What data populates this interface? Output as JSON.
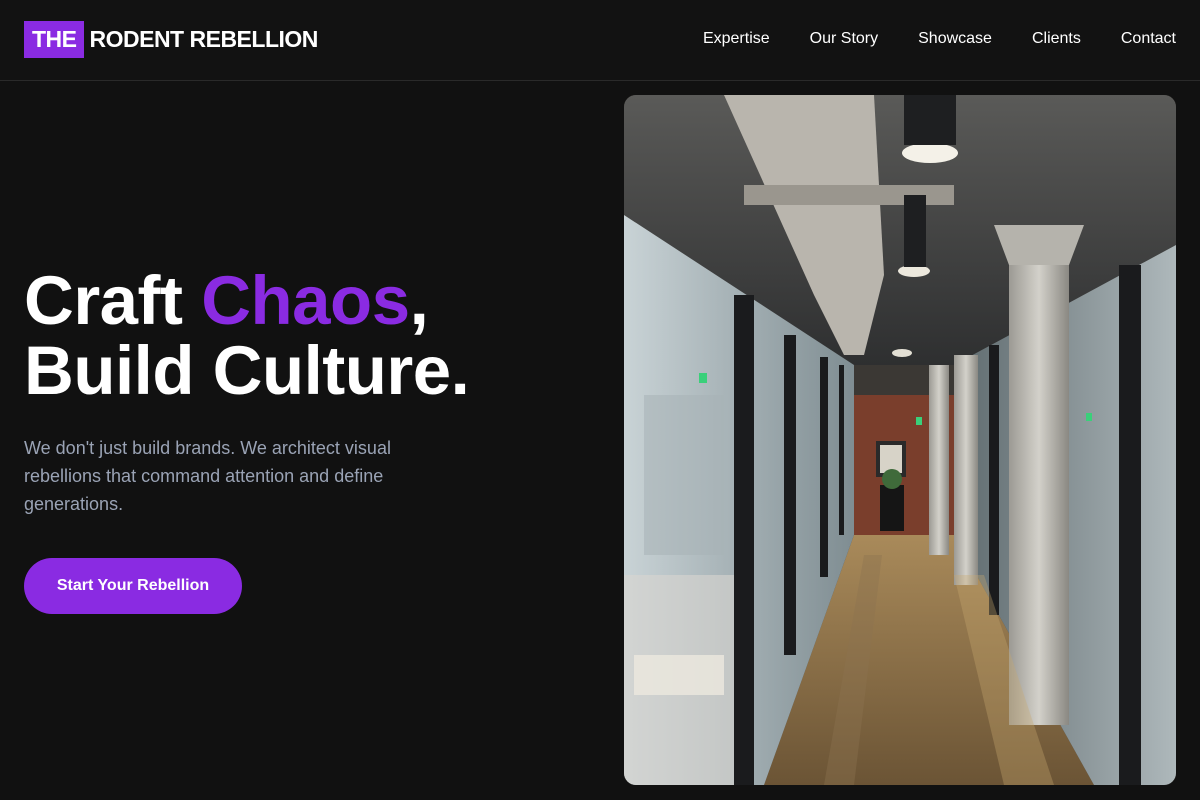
{
  "header": {
    "logo_box": "THE",
    "logo_rest": "RODENT REBELLION",
    "nav": [
      "Expertise",
      "Our Story",
      "Showcase",
      "Clients",
      "Contact"
    ]
  },
  "hero": {
    "title_part1": "Craft ",
    "title_accent": "Chaos",
    "title_part2": ",",
    "title_line2": "Build Culture.",
    "description": "We don't just build brands. We architect visual rebellions that command attention and define generations.",
    "cta_label": "Start Your Rebellion"
  },
  "colors": {
    "accent": "#8a2be2",
    "background": "#111111",
    "text_muted": "#9aa3b5"
  }
}
